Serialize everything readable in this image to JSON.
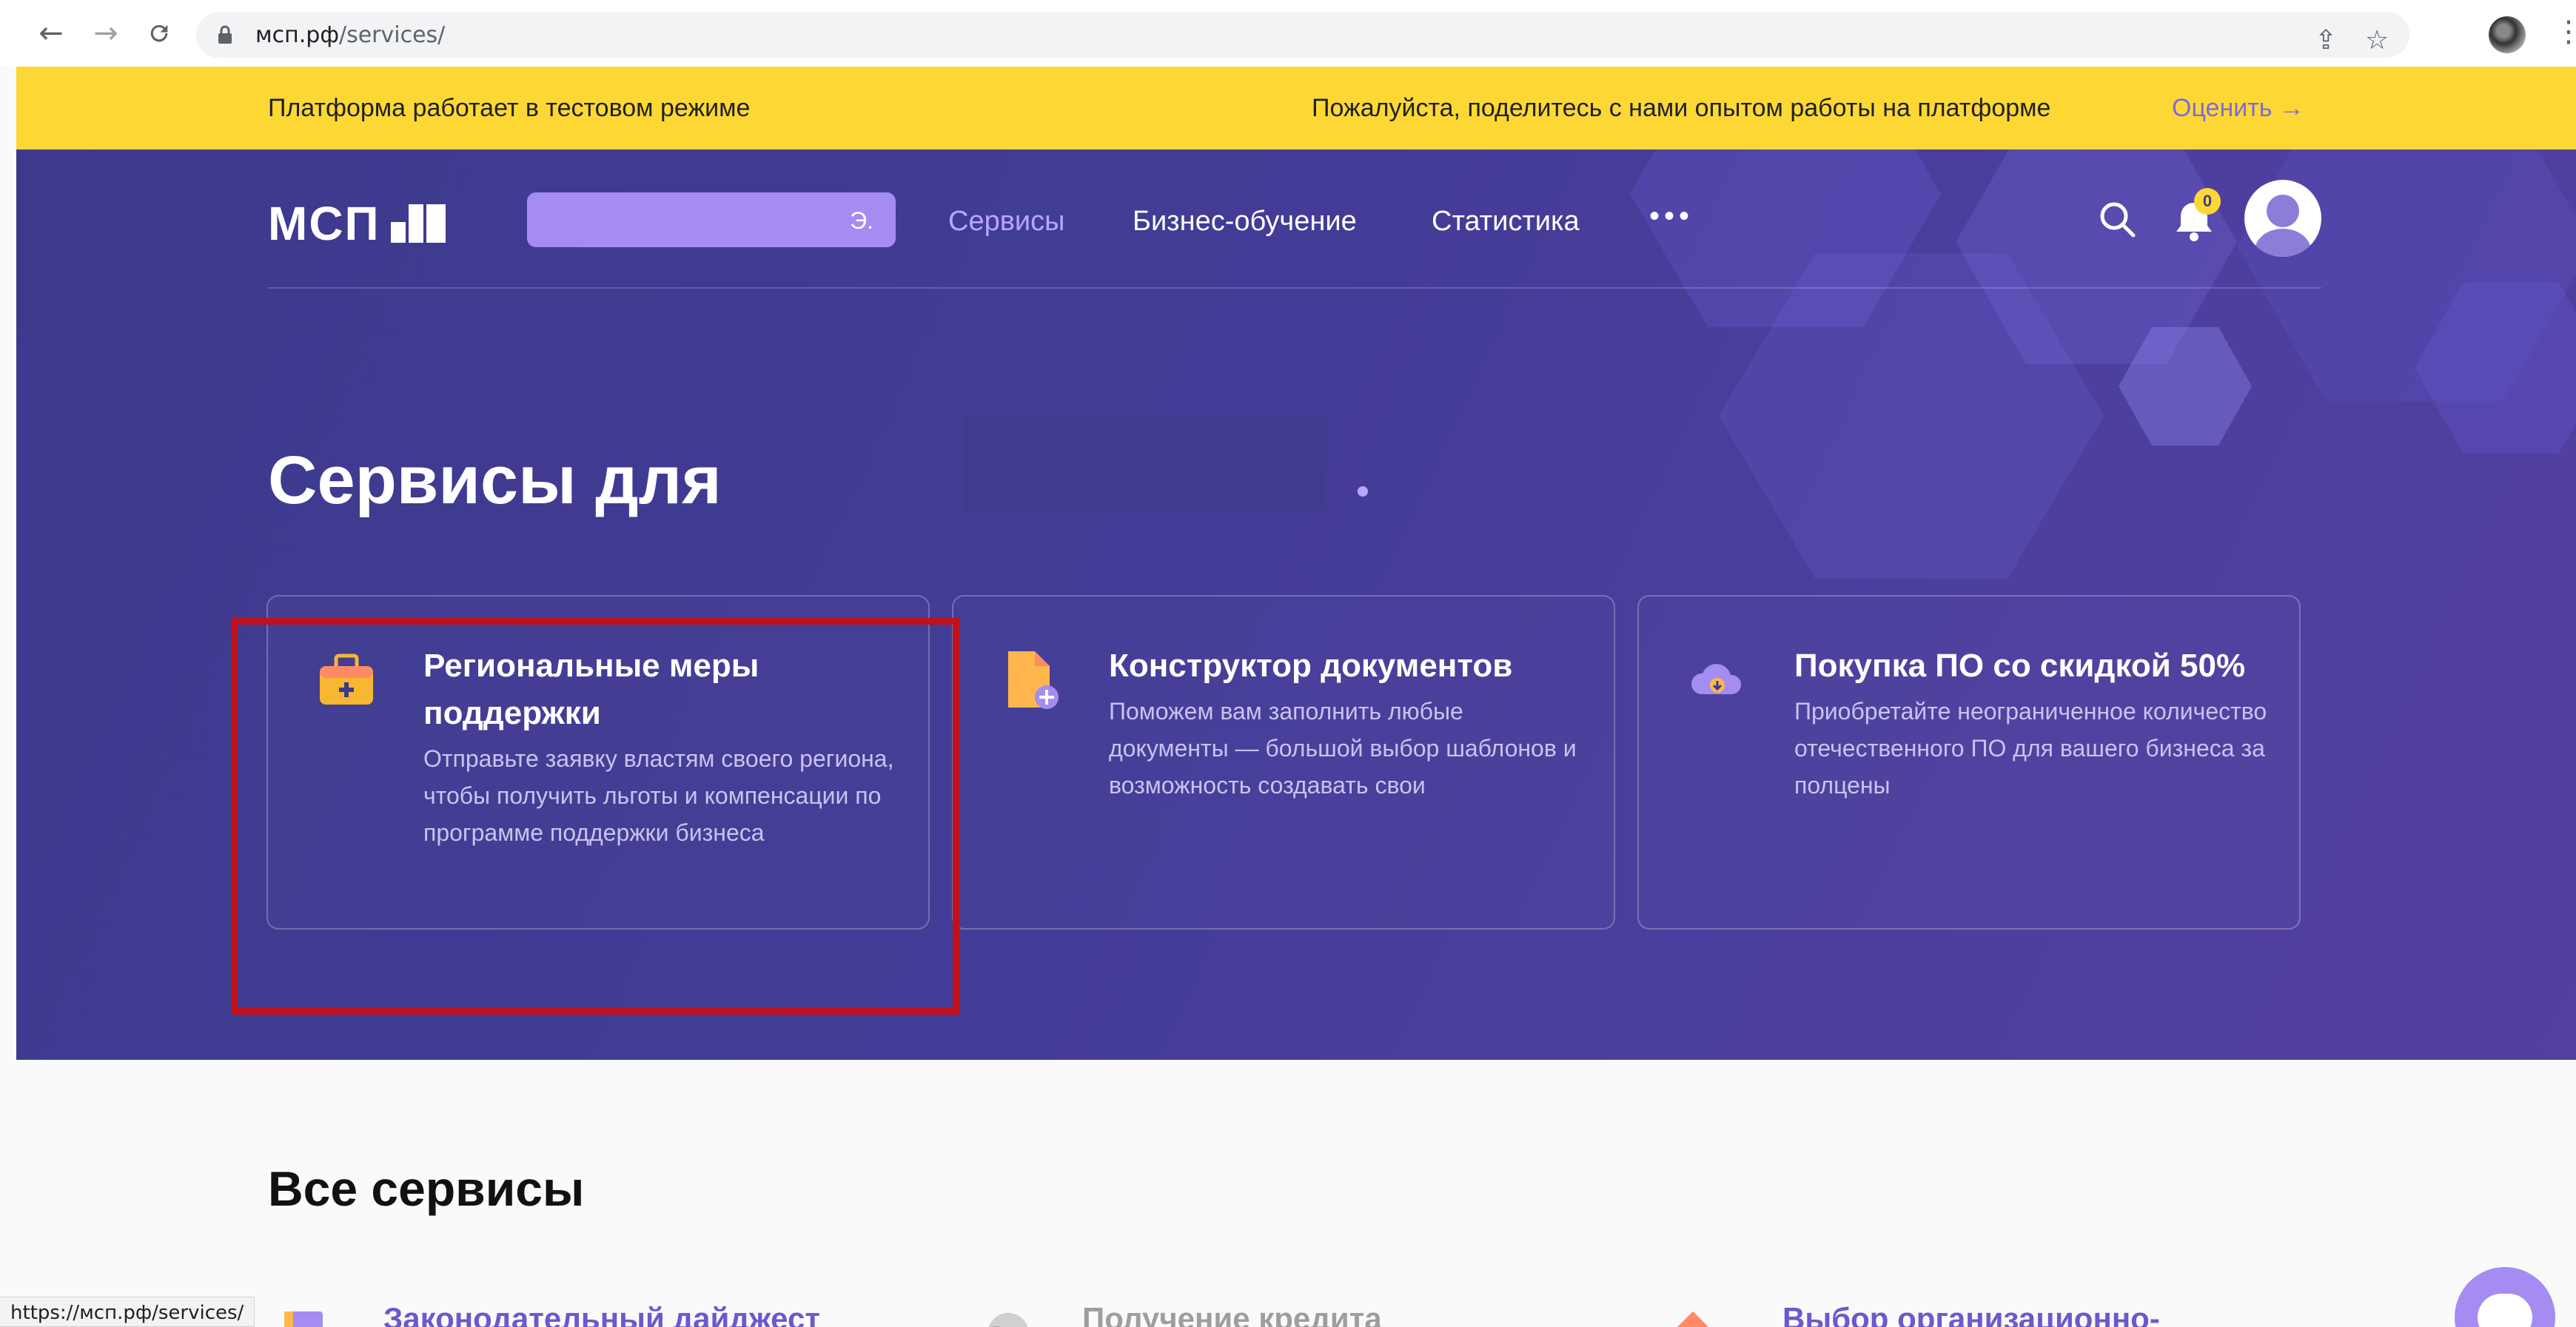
{
  "browser": {
    "back_glyph": "←",
    "forward_glyph": "→",
    "reload_glyph": "C",
    "url_domain": "мсп.рф",
    "url_path": "/services/",
    "share_glyph": "⇪",
    "star_glyph": "☆",
    "menu_glyph": "⋮"
  },
  "banner": {
    "left_text": "Платформа работает в тестовом режиме",
    "right_text": "Пожалуйста, поделитесь с нами опытом работы на платформе",
    "rate_link": "Оценить →"
  },
  "header": {
    "logo_text": "МСП",
    "search_tail": "Э.",
    "nav": [
      "Сервисы",
      "Бизнес-обучение",
      "Статистика"
    ],
    "more_glyph": "•••",
    "notification_count": "0"
  },
  "hero": {
    "title": "Сервисы для",
    "cards": [
      {
        "title": "Региональные меры поддержки",
        "desc": "Отправьте заявку властям своего региона, чтобы получить льготы и компенсации по программе поддержки бизнеса"
      },
      {
        "title": "Конструктор документов",
        "desc": "Поможем вам заполнить любые документы — большой выбор шаблонов и возможность создавать свои"
      },
      {
        "title": "Покупка ПО со скидкой 50%",
        "desc": "Приобретайте неограниченное количество отечественного ПО для вашего бизнеса за полцены"
      }
    ]
  },
  "all_services": {
    "title": "Все сервисы",
    "peek": [
      "Законодательный дайджест",
      "Получение кредита",
      "Выбор организационно-"
    ]
  },
  "status_bar": {
    "url": "https://мсп.рф/services/"
  },
  "icons": {
    "lock": "lock-icon",
    "search": "search-icon",
    "bell": "bell-icon",
    "avatar": "user-avatar",
    "chat": "chat-bubble-icon"
  },
  "colors": {
    "banner": "#fdd835",
    "hero": "#423c96",
    "accent": "#a58cf2",
    "highlight": "#c0101c"
  }
}
